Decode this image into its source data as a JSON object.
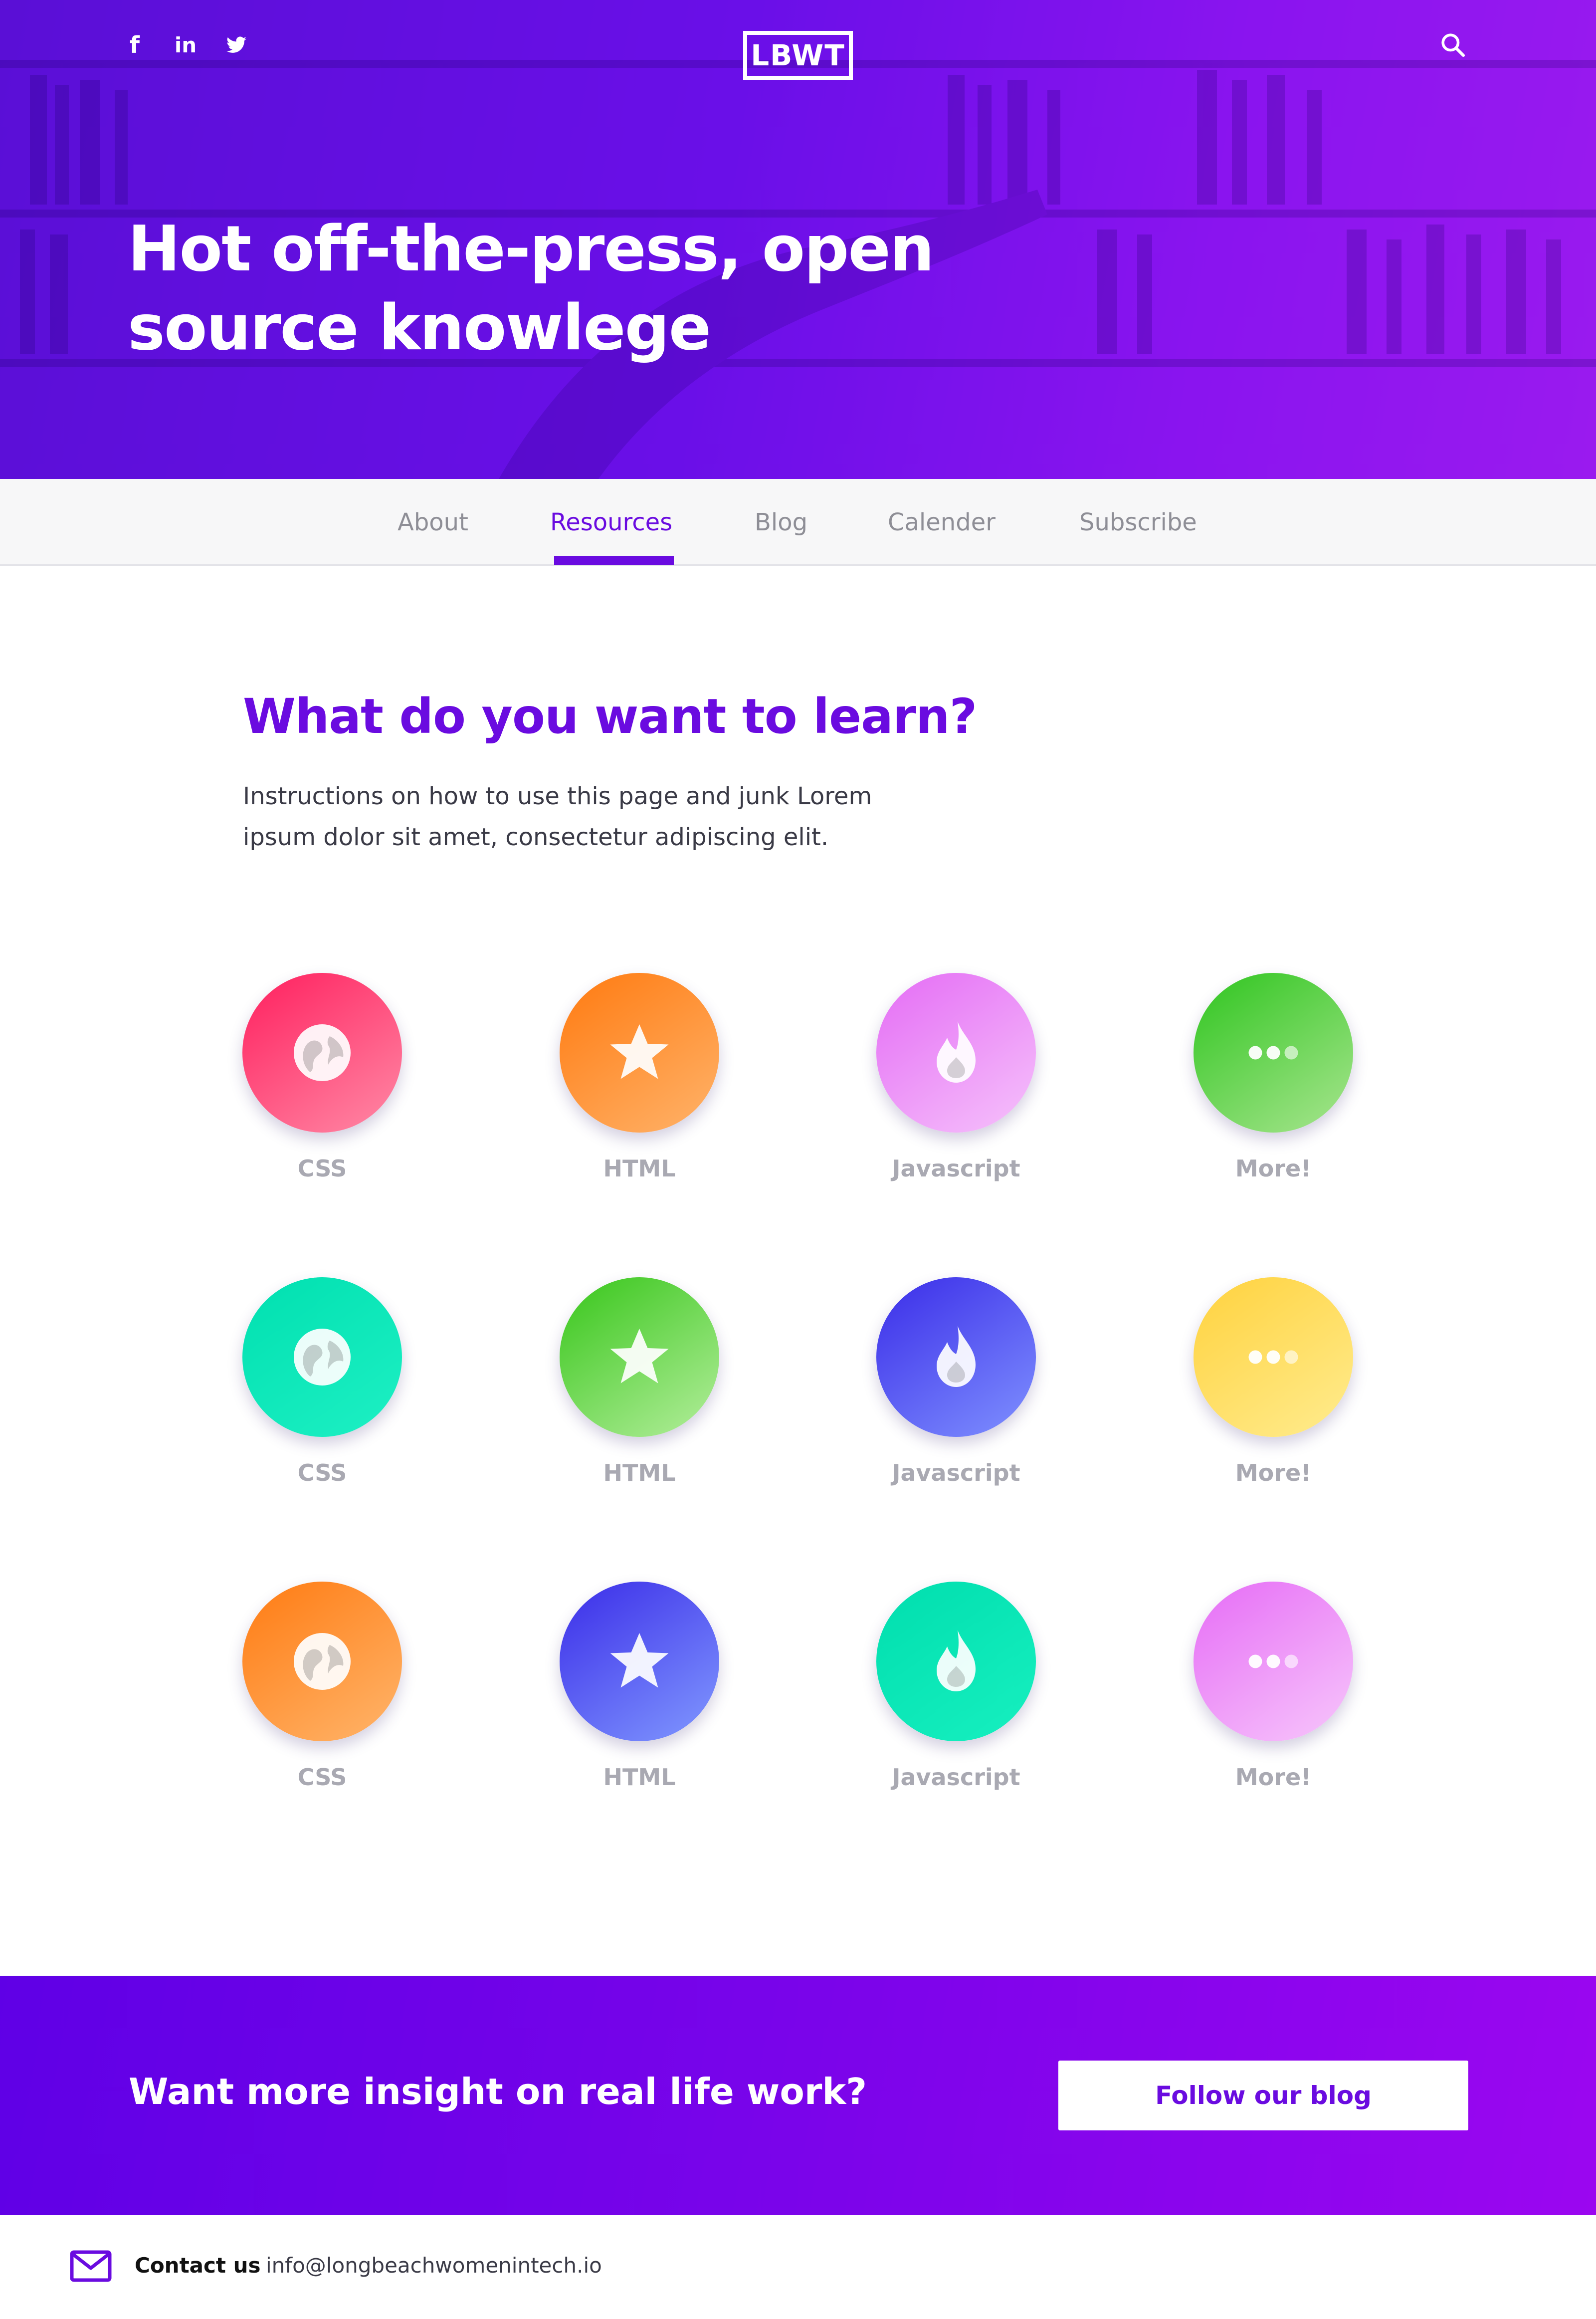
{
  "header": {
    "logo": "LBWT",
    "social": [
      "facebook-icon",
      "linkedin-icon",
      "twitter-icon"
    ],
    "social_text": {
      "facebook": "f",
      "linkedin": "in"
    },
    "title_line1": "Hot off-the-press, open",
    "title_line2": "source knowlege"
  },
  "nav": {
    "items": [
      {
        "label": "About"
      },
      {
        "label": "Resources"
      },
      {
        "label": "Blog"
      },
      {
        "label": "Calender"
      },
      {
        "label": "Subscribe"
      }
    ],
    "active": "Resources"
  },
  "main": {
    "title": "What do you want to learn?",
    "desc_line1": "Instructions on how to use this page and junk Lorem",
    "desc_line2": "ipsum dolor sit amet, consectetur adipiscing elit.",
    "tiles": [
      {
        "label": "CSS",
        "icon": "globe-icon",
        "colors": [
          "#ff1f5e",
          "#ff8aa6"
        ]
      },
      {
        "label": "HTML",
        "icon": "star-icon",
        "colors": [
          "#ff7a10",
          "#ffb36a"
        ]
      },
      {
        "label": "Javascript",
        "icon": "flame-icon",
        "colors": [
          "#e46cf5",
          "#f6c2fb"
        ]
      },
      {
        "label": "More!",
        "icon": "more-icon",
        "colors": [
          "#2fc51f",
          "#a8e58f"
        ]
      },
      {
        "label": "CSS",
        "icon": "globe-icon",
        "colors": [
          "#00e0b0",
          "#1ef0c4"
        ]
      },
      {
        "label": "HTML",
        "icon": "star-icon",
        "colors": [
          "#37c61a",
          "#b4ee9c"
        ]
      },
      {
        "label": "Javascript",
        "icon": "flame-icon",
        "colors": [
          "#3a2ce8",
          "#7f91ff"
        ]
      },
      {
        "label": "More!",
        "icon": "more-icon",
        "colors": [
          "#ffd23e",
          "#ffec8f"
        ]
      },
      {
        "label": "CSS",
        "icon": "globe-icon",
        "colors": [
          "#ff7b12",
          "#ffb56b"
        ]
      },
      {
        "label": "HTML",
        "icon": "star-icon",
        "colors": [
          "#3a2ce8",
          "#8199ff"
        ]
      },
      {
        "label": "Javascript",
        "icon": "flame-icon",
        "colors": [
          "#00deae",
          "#17f0c0"
        ]
      },
      {
        "label": "More!",
        "icon": "more-icon",
        "colors": [
          "#e66cf6",
          "#f7c7fb"
        ]
      }
    ]
  },
  "cta": {
    "text": "Want more insight on real life work?",
    "button": "Follow our blog"
  },
  "footer": {
    "contact_label": "Contact us",
    "email": "info@longbeachwomenintech.io"
  },
  "colors": {
    "accent": "#6a0be0",
    "hero_start": "#5a0fd6",
    "hero_end": "#9a1aef",
    "label_gray": "#a9a9b2"
  }
}
